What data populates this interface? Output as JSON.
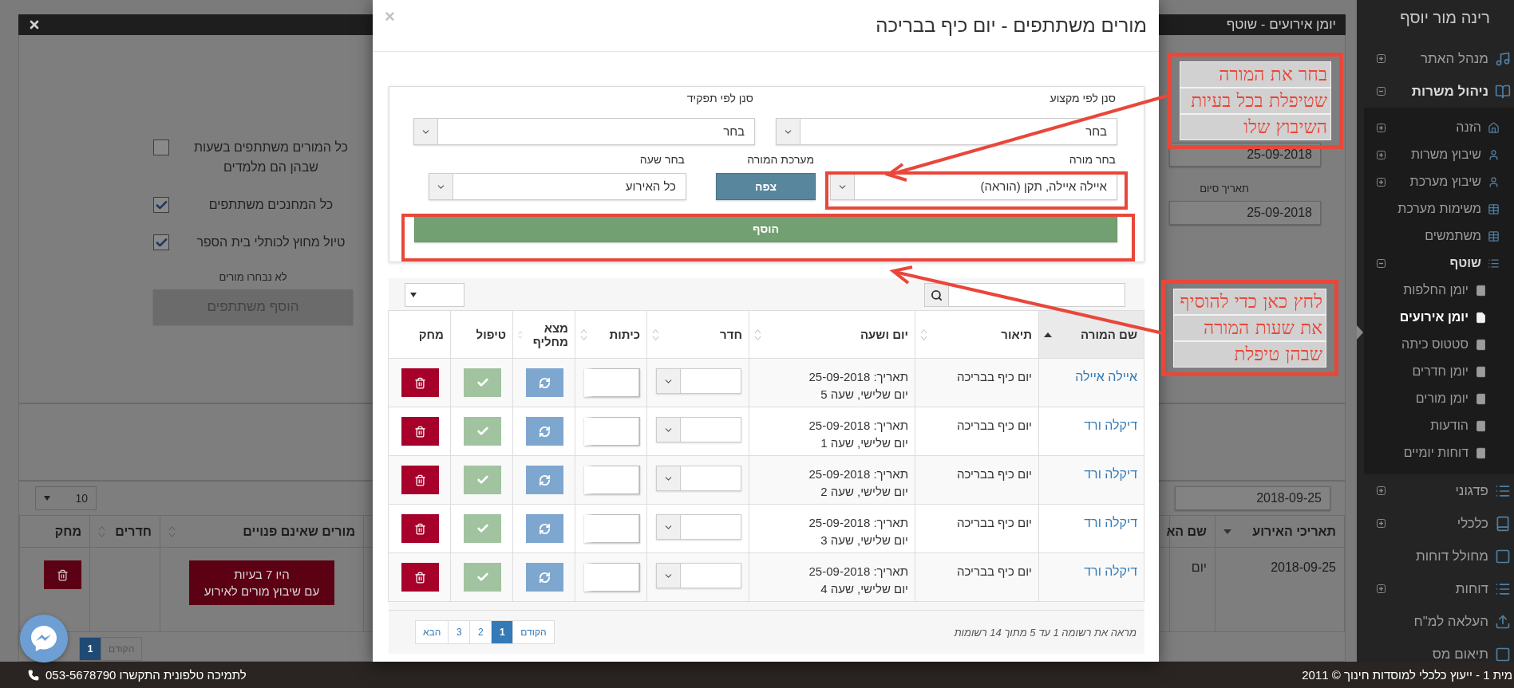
{
  "sidebar": {
    "user": "רינה מור יוסף",
    "items": [
      {
        "label": "מנהל האתר",
        "expanded": false,
        "selected": false
      },
      {
        "label": "ניהול משרות",
        "expanded": true,
        "selected": false,
        "children": [
          {
            "label": "הזנה",
            "expanded": false,
            "selected": false
          },
          {
            "label": "שיבוץ משרות",
            "expanded": false,
            "selected": false
          },
          {
            "label": "שיבוץ מערכת",
            "expanded": false,
            "selected": false
          },
          {
            "label": "משימות מערכת",
            "selected": false
          },
          {
            "label": "משתמשים",
            "selected": false
          },
          {
            "label": "שוטף",
            "expanded": true,
            "selected": false,
            "children": [
              {
                "label": "יומן החלפות",
                "selected": false
              },
              {
                "label": "יומן אירועים",
                "selected": true
              },
              {
                "label": "סטטוס כיתה",
                "selected": false
              },
              {
                "label": "יומן חדרים",
                "selected": false
              },
              {
                "label": "יומן מורים",
                "selected": false
              },
              {
                "label": "הודעות",
                "selected": false
              },
              {
                "label": "דוחות יומיים",
                "selected": false
              }
            ]
          }
        ]
      },
      {
        "label": "פדגוני",
        "expanded": false,
        "selected": false
      },
      {
        "label": "כלכלי",
        "expanded": false,
        "selected": false
      },
      {
        "label": "מחולל דוחות",
        "selected": false
      },
      {
        "label": "דוחות",
        "expanded": false,
        "selected": false
      },
      {
        "label": "העלאה למ\"ח",
        "selected": false
      },
      {
        "label": "תיאום מס",
        "selected": false
      }
    ]
  },
  "page": {
    "title": "יומן אירועים - שוטף"
  },
  "background_form": {
    "checkboxes": [
      {
        "label": "כל המורים משתתפים בשעות שבהן הם מלמדים",
        "checked": false
      },
      {
        "label": "כל המחנכים משתתפים",
        "checked": true
      },
      {
        "label": "טיול מחוץ לכותלי בית הספר",
        "checked": true
      }
    ],
    "note": "לא נבחרו מורים",
    "add_button": "הוסף משתתפים",
    "start_date": "25-09-2018",
    "end_date_label": "תאריך סיום",
    "end_date": "25-09-2018"
  },
  "background_table": {
    "page_size": "10",
    "date_filter": "2018-09-25",
    "columns": [
      {
        "label": "תאריכי האירוע",
        "sorted": true,
        "ascending": false
      },
      {
        "label": "שם הא"
      },
      {},
      {
        "label": "מורים שאינם פנויים",
        "sorted": false
      },
      {
        "label": "חדרים",
        "sorted": false
      },
      {
        "label": "מחק"
      }
    ],
    "rows": [
      {
        "date": "2018-09-25",
        "name": "יום",
        "problems_button": [
          "היו 7 בעיות",
          "עם שיבוץ מורים לאירוע"
        ]
      }
    ],
    "pages": [
      {
        "label": "הקודם",
        "selected": false
      },
      {
        "label": "1",
        "selected": true
      }
    ]
  },
  "modal": {
    "title": "מורים משתתפים - יום כיף בבריכה",
    "close": "×",
    "filters": [
      {
        "label": "סנן לפי מקצוע",
        "value": "בחר"
      },
      {
        "label": "סנן לפי תפקיד",
        "value": "בחר"
      }
    ],
    "teacher": {
      "label": "בחר מורה",
      "value": "איילה איילה, תקן (הוראה)"
    },
    "schedule": {
      "label": "מערכת המורה",
      "button": "צפה"
    },
    "hour": {
      "label": "בחר שעה",
      "value": "כל האירוע"
    },
    "add_button": "הוסף",
    "table": {
      "columns": [
        {
          "label": "שם המורה",
          "sorted": true,
          "ascending": true
        },
        {
          "label": "תיאור",
          "sorted": false
        },
        {
          "label": "יום ושעה",
          "sorted": false
        },
        {
          "label": "חדר",
          "sorted": false
        },
        {
          "label": "כיתות",
          "sorted": false
        },
        {
          "label": "מצא מחליף",
          "sorted": false
        },
        {
          "label": "טיפול"
        },
        {
          "label": "מחק"
        }
      ],
      "rows": [
        {
          "teacher": "איילה איילה",
          "description": "יום כיף בבריכה",
          "date": "תאריך: 25-09-2018",
          "time": "יום שלישי, שעה 5"
        },
        {
          "teacher": "דיקלה ורד",
          "description": "יום כיף בבריכה",
          "date": "תאריך: 25-09-2018",
          "time": "יום שלישי, שעה 1"
        },
        {
          "teacher": "דיקלה ורד",
          "description": "יום כיף בבריכה",
          "date": "תאריך: 25-09-2018",
          "time": "יום שלישי, שעה 2"
        },
        {
          "teacher": "דיקלה ורד",
          "description": "יום כיף בבריכה",
          "date": "תאריך: 25-09-2018",
          "time": "יום שלישי, שעה 3"
        },
        {
          "teacher": "דיקלה ורד",
          "description": "יום כיף בבריכה",
          "date": "תאריך: 25-09-2018",
          "time": "יום שלישי, שעה 4"
        }
      ],
      "info": "מראה את רשומה 1 עד 5 מתוך 14 רשומות",
      "pages": [
        {
          "label": "הקודם",
          "selected": false
        },
        {
          "label": "1",
          "selected": true
        },
        {
          "label": "2",
          "selected": false
        },
        {
          "label": "3",
          "selected": false
        },
        {
          "label": "הבא",
          "selected": false
        }
      ]
    }
  },
  "annotations": [
    {
      "lines": [
        "בחר את המורה",
        "שטיפלת בכל בעיות",
        "השיבוץ שלו"
      ]
    },
    {
      "lines": [
        "לחץ כאן כדי להוסיף",
        "את שעות המורה",
        "שבהן טיפלת"
      ]
    }
  ],
  "footer": {
    "copyright": "מית 1 - ייעוץ כלכלי למוסדות חינוך © 2011",
    "support": "לתמיכה טלפונית התקשרו 053-5678790"
  }
}
